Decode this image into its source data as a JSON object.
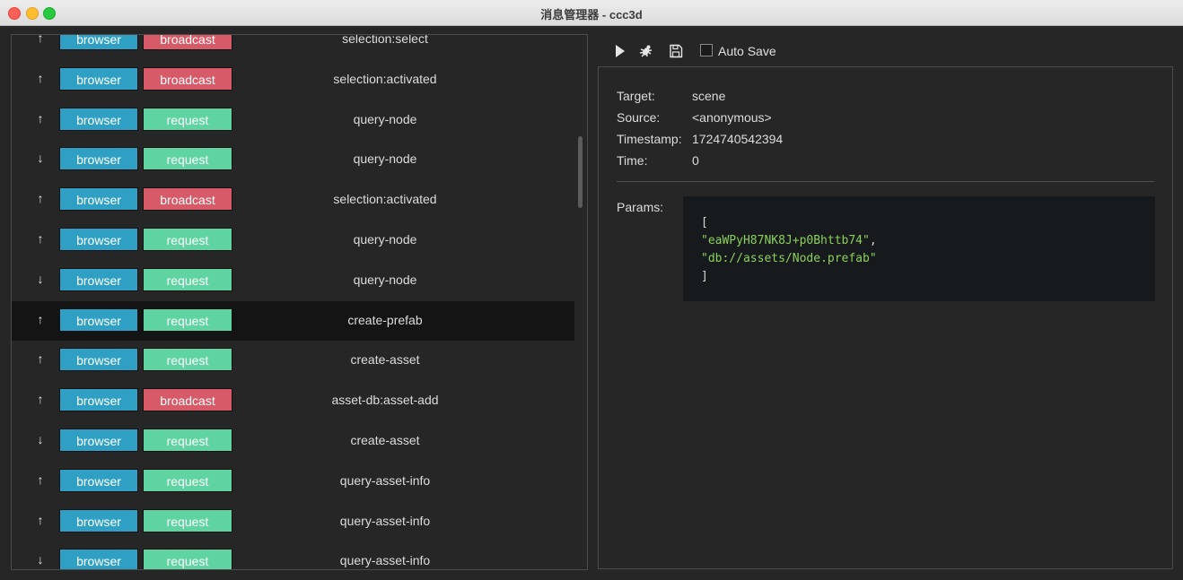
{
  "window": {
    "title": "消息管理器 - ccc3d"
  },
  "list": {
    "rows": [
      {
        "direction": "↑",
        "process": "browser",
        "type": "broadcast",
        "message": "selection:select"
      },
      {
        "direction": "↑",
        "process": "browser",
        "type": "broadcast",
        "message": "selection:activated"
      },
      {
        "direction": "↑",
        "process": "browser",
        "type": "request",
        "message": "query-node"
      },
      {
        "direction": "↓",
        "process": "browser",
        "type": "request",
        "message": "query-node"
      },
      {
        "direction": "↑",
        "process": "browser",
        "type": "broadcast",
        "message": "selection:activated"
      },
      {
        "direction": "↑",
        "process": "browser",
        "type": "request",
        "message": "query-node"
      },
      {
        "direction": "↓",
        "process": "browser",
        "type": "request",
        "message": "query-node"
      },
      {
        "direction": "↑",
        "process": "browser",
        "type": "request",
        "message": "create-prefab",
        "selected": true
      },
      {
        "direction": "↑",
        "process": "browser",
        "type": "request",
        "message": "create-asset"
      },
      {
        "direction": "↑",
        "process": "browser",
        "type": "broadcast",
        "message": "asset-db:asset-add"
      },
      {
        "direction": "↓",
        "process": "browser",
        "type": "request",
        "message": "create-asset"
      },
      {
        "direction": "↑",
        "process": "browser",
        "type": "request",
        "message": "query-asset-info"
      },
      {
        "direction": "↑",
        "process": "browser",
        "type": "request",
        "message": "query-asset-info"
      },
      {
        "direction": "↓",
        "process": "browser",
        "type": "request",
        "message": "query-asset-info"
      }
    ]
  },
  "toolbar": {
    "play_icon": "play-icon",
    "bug_icon": "bug-icon",
    "save_icon": "save-icon",
    "autosave_label": "Auto Save",
    "autosave_checked": false
  },
  "detail": {
    "target_label": "Target:",
    "target_value": "scene",
    "source_label": "Source:",
    "source_value": "<anonymous>",
    "timestamp_label": "Timestamp:",
    "timestamp_value": "1724740542394",
    "time_label": "Time:",
    "time_value": "0",
    "params_label": "Params:",
    "params": {
      "open": "[",
      "item1": "\"eaWPyH87NK8J+p0Bhttb74\"",
      "comma": ",",
      "item2": "\"db://assets/Node.prefab\"",
      "close": "]"
    }
  },
  "colors": {
    "process_tag": "#2fa0c4",
    "request_tag": "#5fd4a2",
    "broadcast_tag": "#d65a67",
    "string_literal": "#8ccf5a"
  }
}
